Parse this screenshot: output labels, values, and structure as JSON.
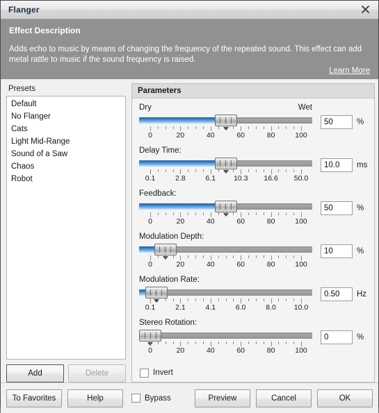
{
  "window": {
    "title": "Flanger",
    "close_icon": "close-icon"
  },
  "description": {
    "heading": "Effect Description",
    "text": "Adds echo to music by means of changing the frequency of the repeated sound. This effect can add metal rattle to music if the sound frequency is raised.",
    "learn_more": "Learn More"
  },
  "presets": {
    "label": "Presets",
    "items": [
      "Default",
      "No Flanger",
      "Cats",
      "Light Mid-Range",
      "Sound of a Saw",
      "Chaos",
      "Robot"
    ],
    "add_label": "Add",
    "delete_label": "Delete"
  },
  "parameters": {
    "header": "Parameters",
    "rows": [
      {
        "label": "Dry",
        "label_right": "Wet",
        "value": "50",
        "unit": "%",
        "percent": 50,
        "ticks": [
          "0",
          "20",
          "40",
          "60",
          "80",
          "100"
        ]
      },
      {
        "label": "Delay Time:",
        "label_right": "",
        "value": "10.0",
        "unit": "ms",
        "percent": 50,
        "ticks": [
          "0.1",
          "2.8",
          "6.1",
          "10.3",
          "16.6",
          "50.0"
        ]
      },
      {
        "label": "Feedback:",
        "label_right": "",
        "value": "50",
        "unit": "%",
        "percent": 50,
        "ticks": [
          "0",
          "20",
          "40",
          "60",
          "80",
          "100"
        ]
      },
      {
        "label": "Modulation Depth:",
        "label_right": "",
        "value": "10",
        "unit": "%",
        "percent": 10,
        "ticks": [
          "0",
          "20",
          "40",
          "60",
          "80",
          "100"
        ]
      },
      {
        "label": "Modulation Rate:",
        "label_right": "",
        "value": "0.50",
        "unit": "Hz",
        "percent": 4,
        "ticks": [
          "0.1",
          "2.1",
          "4.1",
          "6.0",
          "8.0",
          "10.0"
        ]
      },
      {
        "label": "Stereo Rotation:",
        "label_right": "",
        "value": "0",
        "unit": "%",
        "percent": 0,
        "ticks": [
          "0",
          "20",
          "40",
          "60",
          "80",
          "100"
        ]
      }
    ],
    "invert_label": "Invert",
    "invert_checked": false
  },
  "footer": {
    "to_favorites": "To Favorites",
    "help": "Help",
    "bypass_label": "Bypass",
    "bypass_checked": false,
    "preview": "Preview",
    "cancel": "Cancel",
    "ok": "OK"
  },
  "colors": {
    "accent": "#3f86cf",
    "description_bg": "#919191",
    "title_text": "#1d2f4a"
  }
}
